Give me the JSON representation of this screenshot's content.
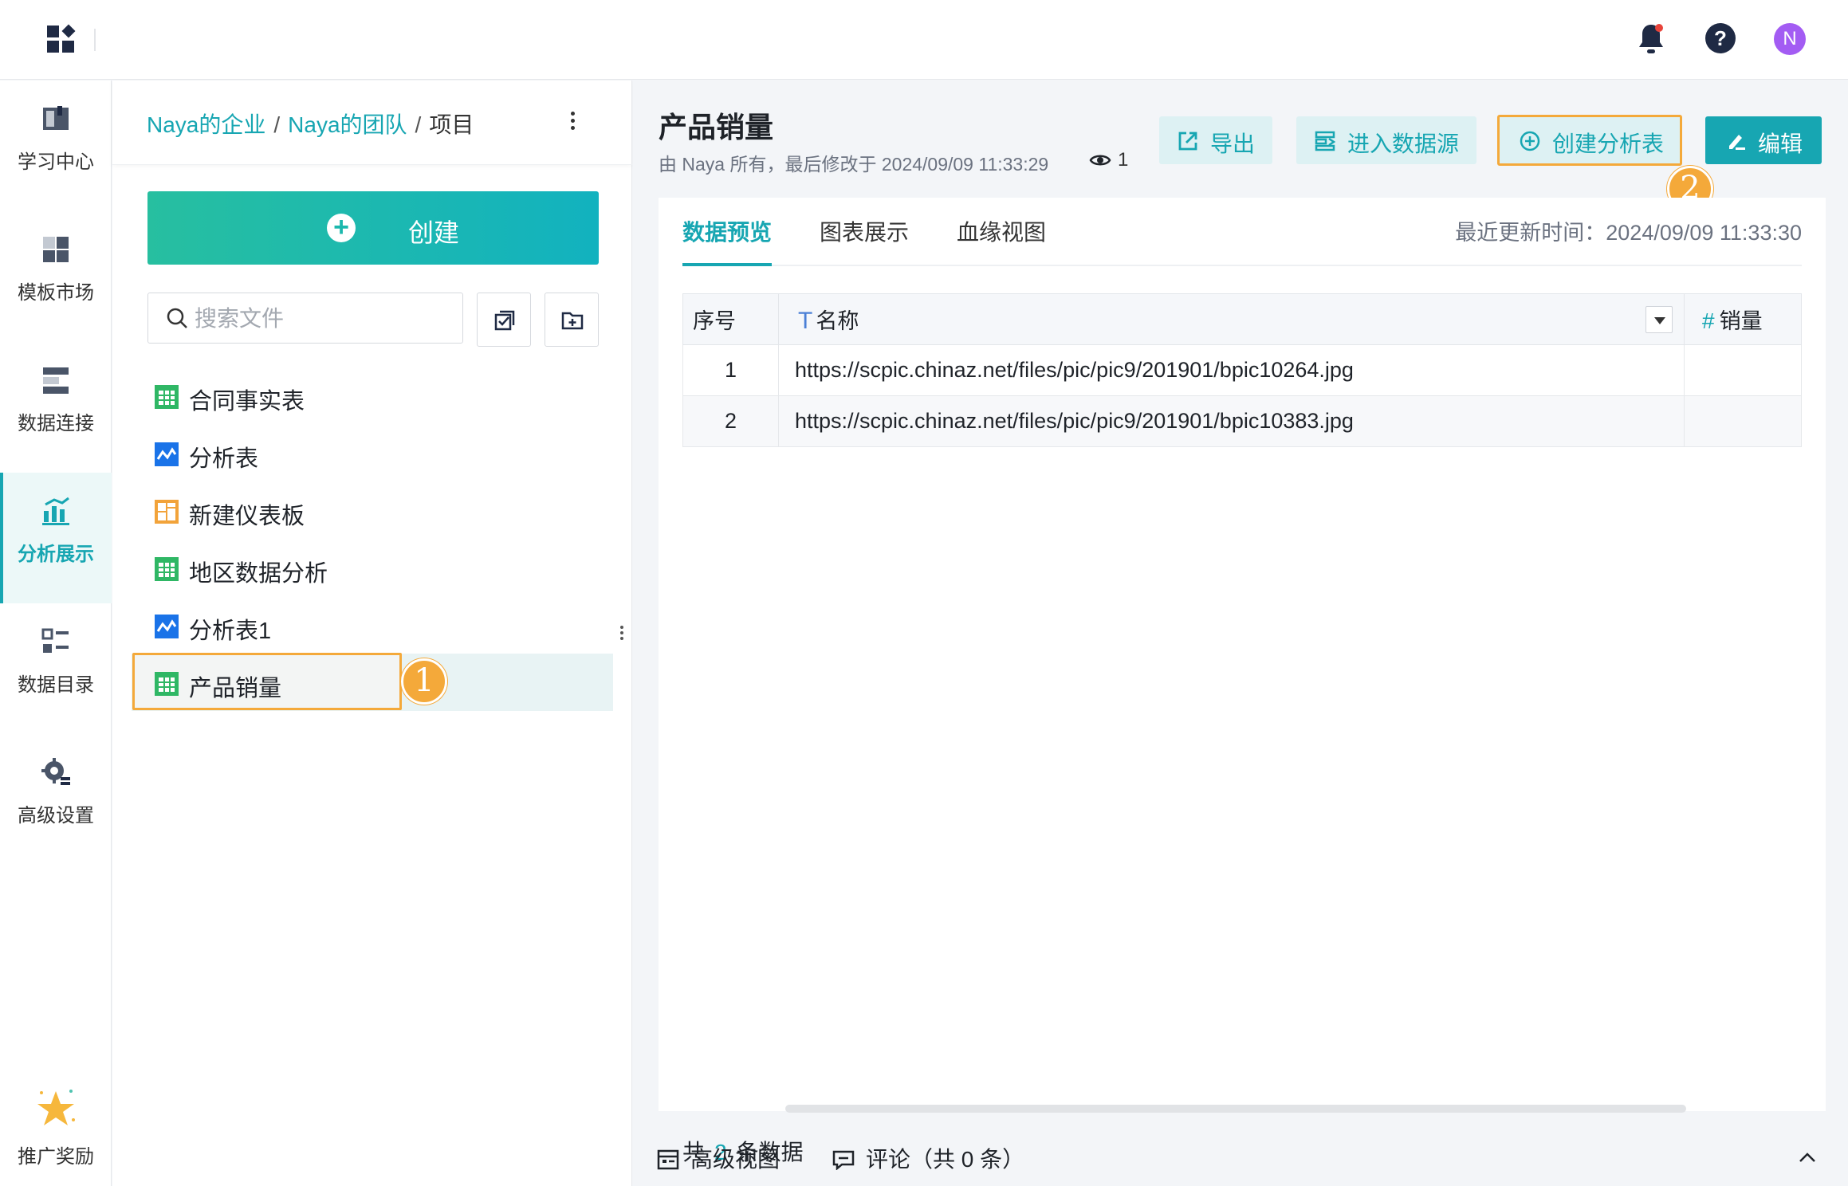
{
  "leftnav": {
    "items": [
      {
        "label": "学习中心",
        "icon": "book-icon"
      },
      {
        "label": "模板市场",
        "icon": "template-icon"
      },
      {
        "label": "数据连接",
        "icon": "data-connect-icon"
      },
      {
        "label": "分析展示",
        "icon": "chart-icon"
      },
      {
        "label": "数据目录",
        "icon": "catalog-icon"
      },
      {
        "label": "高级设置",
        "icon": "gear-icon"
      }
    ],
    "active": "分析展示",
    "promo_label": "推广奖励"
  },
  "topbar": {
    "avatar_letter": "N",
    "help_glyph": "?"
  },
  "filepanel": {
    "breadcrumb": {
      "org": "Naya的企业",
      "team": "Naya的团队",
      "current": "项目",
      "sep": "/"
    },
    "create_label": "创建",
    "search_placeholder": "搜索文件",
    "files": [
      {
        "name": "合同事实表",
        "type": "table"
      },
      {
        "name": "分析表",
        "type": "analysis"
      },
      {
        "name": "新建仪表板",
        "type": "dashboard"
      },
      {
        "name": "地区数据分析",
        "type": "table"
      },
      {
        "name": "分析表1",
        "type": "analysis"
      },
      {
        "name": "产品销量",
        "type": "table"
      }
    ],
    "selected": "产品销量"
  },
  "annotations": {
    "step1": "1",
    "step2": "2"
  },
  "main": {
    "title": "产品销量",
    "meta": "由 Naya 所有，最后修改于 2024/09/09 11:33:29",
    "view_count": "1",
    "buttons": {
      "export": "导出",
      "enter_source": "进入数据源",
      "create_analysis": "创建分析表",
      "edit": "编辑"
    },
    "tabs": [
      "数据预览",
      "图表展示",
      "血缘视图"
    ],
    "active_tab": "数据预览",
    "updated": "最近更新时间：2024/09/09 11:33:30",
    "table": {
      "headers": {
        "index": "序号",
        "name_type": "T",
        "name": "名称",
        "sales_type": "#",
        "sales": "销量"
      },
      "rows": [
        {
          "index": "1",
          "name": "https://scpic.chinaz.net/files/pic/pic9/201901/bpic10264.jpg",
          "sales": ""
        },
        {
          "index": "2",
          "name": "https://scpic.chinaz.net/files/pic/pic9/201901/bpic10383.jpg",
          "sales": ""
        }
      ]
    },
    "count": {
      "prefix": "共",
      "num": "2",
      "suffix": "条数据"
    },
    "bottom": {
      "advanced_view": "高级视图",
      "comments": "评论（共 0 条）"
    }
  },
  "colors": {
    "accent": "#17a6b2",
    "highlight": "#f4a93a",
    "avatar": "#a35cf3"
  }
}
